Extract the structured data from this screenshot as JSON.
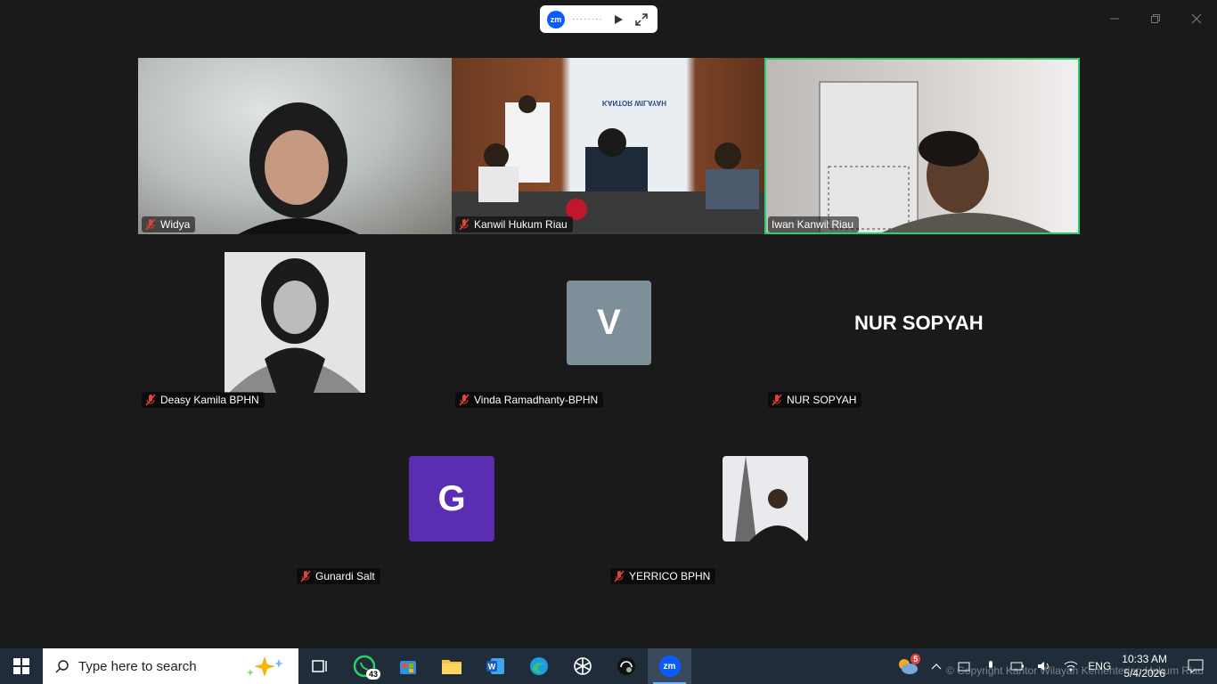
{
  "window": {
    "app_logo": "zm",
    "pill_dots": "········",
    "controls": [
      "minimize-icon",
      "restore-icon",
      "close-icon"
    ]
  },
  "participants": {
    "tile1": {
      "name": "Widya",
      "muted": true
    },
    "tile2": {
      "name": "Kanwil Hukum Riau",
      "muted": true,
      "banner": "KANTOR WILAYAH"
    },
    "tile3": {
      "name": "Iwan Kanwil Riau",
      "muted": false,
      "active_speaker": true
    },
    "tile4": {
      "name": "Deasy Kamila BPHN",
      "muted": true
    },
    "tile5": {
      "name": "Vinda Ramadhanty-BPHN",
      "muted": true,
      "avatar_letter": "V",
      "avatar_color": "#7d8f99"
    },
    "tile6": {
      "name": "NUR SOPYAH",
      "muted": true,
      "display_name": "NUR SOPYAH"
    },
    "tile7": {
      "name": "Gunardi Salt",
      "muted": true,
      "avatar_letter": "G",
      "avatar_color": "#5b2db0"
    },
    "tile8": {
      "name": "YERRICO BPHN",
      "muted": true
    }
  },
  "accent": {
    "active_border": "#2ecc71",
    "muted_mic": "#e0413a"
  },
  "taskbar": {
    "search_placeholder": "Type here to search",
    "whatsapp_badge": "43",
    "weather_badge": "5",
    "language": "ENG",
    "time": "10:33 AM",
    "date": "5/4/2026",
    "apps": [
      "task-view",
      "whatsapp",
      "microsoft-store",
      "file-explorer",
      "word",
      "edge",
      "chatgpt",
      "wifi-app",
      "zoom"
    ]
  },
  "watermark": "© Copyright Kantor Wilayah Kementerian Hukum Riau"
}
